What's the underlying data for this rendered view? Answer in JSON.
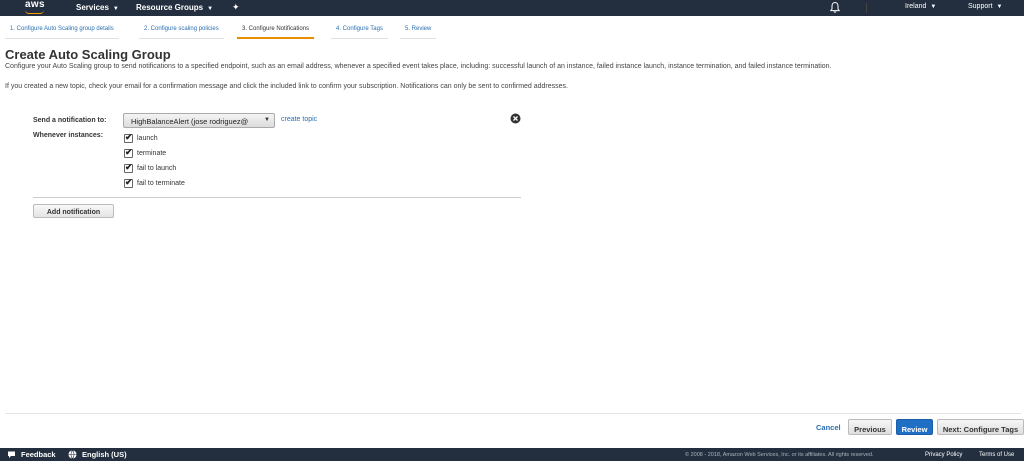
{
  "topnav": {
    "logo_text": "aws",
    "services": "Services",
    "resource_groups": "Resource Groups",
    "region": "Ireland",
    "support": "Support"
  },
  "tabs": [
    {
      "label": "1. Configure Auto Scaling group details"
    },
    {
      "label": "2. Configure scaling policies"
    },
    {
      "label": "3. Configure Notifications",
      "active": true
    },
    {
      "label": "4. Configure Tags"
    },
    {
      "label": "5. Review"
    }
  ],
  "page": {
    "title": "Create Auto Scaling Group",
    "description": "Configure your Auto Scaling group to send notifications to a specified endpoint, such as an email address, whenever a specified event takes place, including: successful launch of an instance, failed instance launch, instance termination, and failed instance termination.",
    "note": "If you created a new topic, check your email for a confirmation message and click the included link to confirm your subscription. Notifications can only be sent to confirmed addresses."
  },
  "notification": {
    "send_label": "Send a notification to:",
    "topic_value": "HighBalanceAlert (jose rodriguez@",
    "create_topic": "create topic",
    "whenever_label": "Whenever instances:",
    "events": [
      {
        "label": "launch",
        "checked": true
      },
      {
        "label": "terminate",
        "checked": true
      },
      {
        "label": "fail to launch",
        "checked": true
      },
      {
        "label": "fail to terminate",
        "checked": true
      }
    ],
    "add_button": "Add notification"
  },
  "actions": {
    "cancel": "Cancel",
    "previous": "Previous",
    "review": "Review",
    "next": "Next: Configure Tags"
  },
  "footer": {
    "feedback": "Feedback",
    "language": "English (US)",
    "copyright": "© 2008 - 2018, Amazon Web Services, Inc. or its affiliates. All rights reserved.",
    "privacy": "Privacy Policy",
    "terms": "Terms of Use"
  },
  "colors": {
    "nav_bg": "#232f3e",
    "accent": "#ff9900",
    "link": "#2a6fb0",
    "primary_button": "#1f6fc5"
  }
}
